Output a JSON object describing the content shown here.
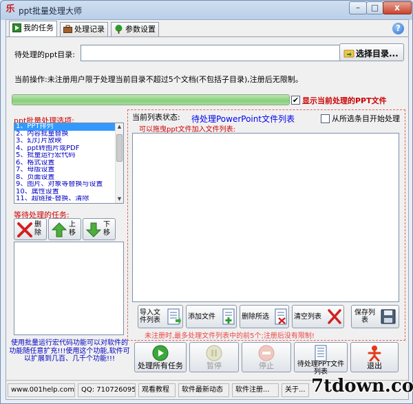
{
  "window": {
    "title": "ppt批量处理大师",
    "app_icon": "乐",
    "controls": {
      "minimize": "–",
      "maximize": "□",
      "close": "x"
    }
  },
  "tabs": [
    {
      "label": "我的任务",
      "icon": "play-icon",
      "active": true
    },
    {
      "label": "处理记录",
      "icon": "briefcase-icon",
      "active": false
    },
    {
      "label": "参数设置",
      "icon": "tree-icon",
      "active": false
    }
  ],
  "help": {
    "glyph": "?"
  },
  "directory": {
    "label": "待处理的ppt目录:",
    "value": "",
    "select_button": "选择目录..."
  },
  "current_operation": "当前操作:未注册用户限于处理当前目录不超过5个文档(不包括子目录),注册后无限制。",
  "progress": {
    "fraction": 1.0
  },
  "show_current": {
    "checked": true,
    "label": "显示当前处理的PPT文件"
  },
  "options": {
    "title": "ppt批量处理选项:",
    "items": [
      "1、PPT排列",
      "2、内容批量替换",
      "3、幻灯片放映",
      "4、ppt转图片或PDF",
      "5、批量运行宏代码",
      "6、格式设置",
      "7、母版设置",
      "8、页面设置",
      "9、图片、对象等替换与设置",
      "10、属性设置",
      "11、超链接-替换、清除"
    ],
    "selected_index": 0
  },
  "waiting": {
    "title": "等待处理的任务:",
    "buttons": {
      "delete": "删除",
      "up": "上移",
      "down": "下移"
    }
  },
  "note": "使用批量运行宏代码功能可以对软件的功能随任意扩充!!!使用这个功能,软件可以扩展到几百、几千个功能!!!",
  "file_group": {
    "status_label": "当前列表状态:",
    "title": "待处理PowerPoint文件列表",
    "subtitle": "可以拖曳ppt文件加入文件列表:",
    "from_selected": {
      "checked": false,
      "label": "从所选条目开始处理"
    },
    "buttons": {
      "import": "导入文件列表",
      "add": "添加文件",
      "delete_selected": "删除所选",
      "clear": "清空列表",
      "save": "保存列表"
    },
    "limit_note": "未注册时,最多处理文件列表中的前5个;注册后没有限制!"
  },
  "bottom_buttons": {
    "process_all": "处理所有任务",
    "pause": "暂停",
    "stop": "停止",
    "pending_list": "待处理PPT文件列表",
    "exit": "退出"
  },
  "statusbar": {
    "site": "www.001help.com",
    "qq": "QQ: 710726095",
    "tutorial": "观看教程",
    "news": "软件最新动态",
    "register": "软件注册...",
    "about": "关于..."
  },
  "watermark": "7tdown.com",
  "colors": {
    "accent_red": "#cc0000",
    "accent_blue": "#0000ee",
    "selection": "#3399ff",
    "progress_green": "#86cf78"
  }
}
